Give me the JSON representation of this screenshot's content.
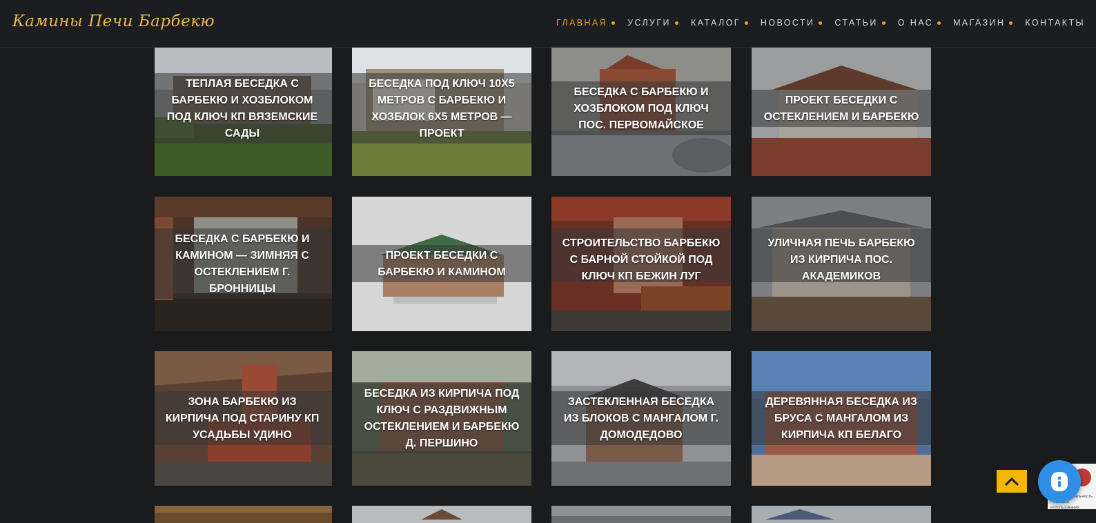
{
  "header": {
    "logo_text": "Камины Печи Барбекю",
    "nav": [
      {
        "label": "ГЛАВНАЯ",
        "active": true
      },
      {
        "label": "УСЛУГИ",
        "active": false
      },
      {
        "label": "КАТАЛОГ",
        "active": false
      },
      {
        "label": "НОВОСТИ",
        "active": false
      },
      {
        "label": "СТАТЬИ",
        "active": false
      },
      {
        "label": "О НАС",
        "active": false
      },
      {
        "label": "МАГАЗИН",
        "active": false
      },
      {
        "label": "КОНТАКТЫ",
        "active": false
      }
    ]
  },
  "cards": [
    {
      "title": "ТЕПЛАЯ БЕСЕДКА С БАРБЕКЮ И ХОЗБЛОКОМ ПОД КЛЮЧ КП ВЯЗЕМСКИЕ САДЫ"
    },
    {
      "title": "БЕСЕДКА ПОД КЛЮЧ 10Х5 МЕТРОВ С БАРБЕКЮ И ХОЗБЛОК 6Х5 МЕТРОВ — ПРОЕКТ"
    },
    {
      "title": "БЕСЕДКА С БАРБЕКЮ И ХОЗБЛОКОМ ПОД КЛЮЧ ПОС. ПЕРВОМАЙСКОЕ"
    },
    {
      "title": "ПРОЕКТ БЕСЕДКИ С ОСТЕКЛЕНИЕМ И БАРБЕКЮ"
    },
    {
      "title": "БЕСЕДКА С БАРБЕКЮ И КАМИНОМ — ЗИМНЯЯ С ОСТЕКЛЕНИЕМ Г. БРОННИЦЫ"
    },
    {
      "title": "ПРОЕКТ БЕСЕДКИ С БАРБЕКЮ И КАМИНОМ"
    },
    {
      "title": "СТРОИТЕЛЬСТВО БАРБЕКЮ С БАРНОЙ СТОЙКОЙ ПОД КЛЮЧ КП БЕЖИН ЛУГ"
    },
    {
      "title": "УЛИЧНАЯ ПЕЧЬ БАРБЕКЮ ИЗ КИРПИЧА ПОС. АКАДЕМИКОВ"
    },
    {
      "title": "ЗОНА БАРБЕКЮ ИЗ КИРПИЧА ПОД СТАРИНУ КП УСАДЬБЫ УДИНО"
    },
    {
      "title": "БЕСЕДКА ИЗ КИРПИЧА ПОД КЛЮЧ С РАЗДВИЖНЫМ ОСТЕКЛЕНИЕМ И БАРБЕКЮ Д. ПЕРШИНО"
    },
    {
      "title": "ЗАСТЕКЛЕННАЯ БЕСЕДКА ИЗ БЛОКОВ С МАНГАЛОМ Г. ДОМОДЕДОВО"
    },
    {
      "title": "ДЕРЕВЯННАЯ БЕСЕДКА ИЗ БРУСА С МАНГАЛОМ ИЗ КИРПИЧА КП БЕЛАГО"
    },
    {
      "title": ""
    },
    {
      "title": ""
    },
    {
      "title": ""
    },
    {
      "title": ""
    }
  ],
  "widgets": {
    "scroll_top_icon": "chevron-up-icon",
    "chat_icon": "chat-icon",
    "recaptcha_text": "Конфиденциальность - Условия использования",
    "accent_color": "#e3a51f",
    "chat_color": "#2f8fe6"
  }
}
